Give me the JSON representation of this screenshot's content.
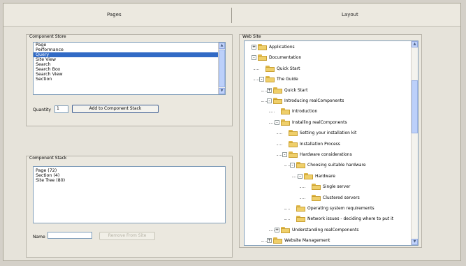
{
  "header": {
    "pages_title": "Pages",
    "layout_title": "Layout"
  },
  "component_store": {
    "title": "Component Store",
    "items": [
      "Page",
      "Performance",
      "Query",
      "Site View",
      "Search",
      "Search Box",
      "Search View",
      "Section"
    ],
    "selected_index": 2,
    "quantity_label": "Quantity",
    "quantity_value": "1",
    "add_button": "Add to Component Stack"
  },
  "component_stack": {
    "title": "Component Stack",
    "items": [
      "Page (72)",
      "Section (4)",
      "Site Tree (80)"
    ],
    "name_label": "Name",
    "name_value": "",
    "remove_button": "Remove From Site"
  },
  "web_site": {
    "title": "Web Site",
    "tree": [
      {
        "label": "Applications",
        "expander": "+"
      },
      {
        "label": "Documentation",
        "expander": "-"
      },
      {
        "label": "Quick Start",
        "expander": ""
      },
      {
        "label": "The Guide",
        "expander": "-"
      },
      {
        "label": "Quick Start",
        "expander": "+"
      },
      {
        "label": "Introducing realComponents",
        "expander": "-"
      },
      {
        "label": "Introduction",
        "expander": ""
      },
      {
        "label": "Installing realComponents",
        "expander": "-"
      },
      {
        "label": "Setting your installation kit",
        "expander": ""
      },
      {
        "label": "Installation Process",
        "expander": ""
      },
      {
        "label": "Hardware considerations",
        "expander": "-"
      },
      {
        "label": "Choosing suitable hardware",
        "expander": "-"
      },
      {
        "label": "Hardware",
        "expander": "-"
      },
      {
        "label": "Single server",
        "expander": ""
      },
      {
        "label": "Clustered servers",
        "expander": ""
      },
      {
        "label": "Operating system requirements",
        "expander": ""
      },
      {
        "label": "Network issues - deciding where to put it",
        "expander": ""
      },
      {
        "label": "Understanding realComponents",
        "expander": "+"
      },
      {
        "label": "Website Management",
        "expander": "+"
      }
    ]
  }
}
